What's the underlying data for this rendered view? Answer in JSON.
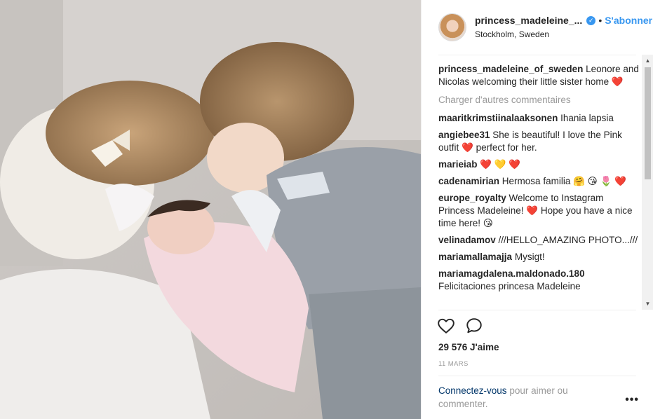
{
  "post": {
    "username": "princess_madeleine_...",
    "verified_badge": "✓",
    "dot": "•",
    "subscribe_label": "S'abonner",
    "location": "Stockholm, Sweden"
  },
  "caption": {
    "user": "princess_madeleine_of_sweden",
    "text": " Leonore and Nicolas welcoming their little sister home ",
    "emoji": "❤️"
  },
  "load_more_label": "Charger d'autres commentaires",
  "comments": [
    {
      "user": "maaritkrimstiinalaaksonen",
      "text": " Ihania lapsia"
    },
    {
      "user": "angiebee31",
      "text": " She is beautiful! I love the Pink outfit ❤️ perfect for her."
    },
    {
      "user": "marieiab",
      "text": " ❤️ 💛 ❤️"
    },
    {
      "user": "cadenamirian",
      "text": " Hermosa familia 🤗 😘 🌷 ❤️"
    },
    {
      "user": "europe_royalty",
      "text": " Welcome to Instagram Princess Madeleine! ❤️ Hope you have a nice time here! 😘"
    },
    {
      "user": "velinadamov",
      "text": " ///HELLO_AMAZING PHOTO...///"
    },
    {
      "user": "mariamallamajja",
      "text": " Mysigt!"
    },
    {
      "user": "mariamagdalena.maldonado.180",
      "text": " Felicitaciones princesa Madeleine"
    }
  ],
  "likes_label": "29 576 J'aime",
  "date_label": "11 MARS",
  "login": {
    "link": "Connectez-vous",
    "text": " pour aimer ou commenter."
  },
  "more_label": "•••",
  "scrollbar": {
    "up": "▲",
    "down": "▼"
  },
  "icons": {
    "like": "heart-outline-icon",
    "comment": "speech-bubble-icon",
    "verified": "verified-badge-icon"
  },
  "colors": {
    "accent": "#3897f0",
    "text": "#262626",
    "muted": "#999999",
    "heart": "#ed4956"
  }
}
